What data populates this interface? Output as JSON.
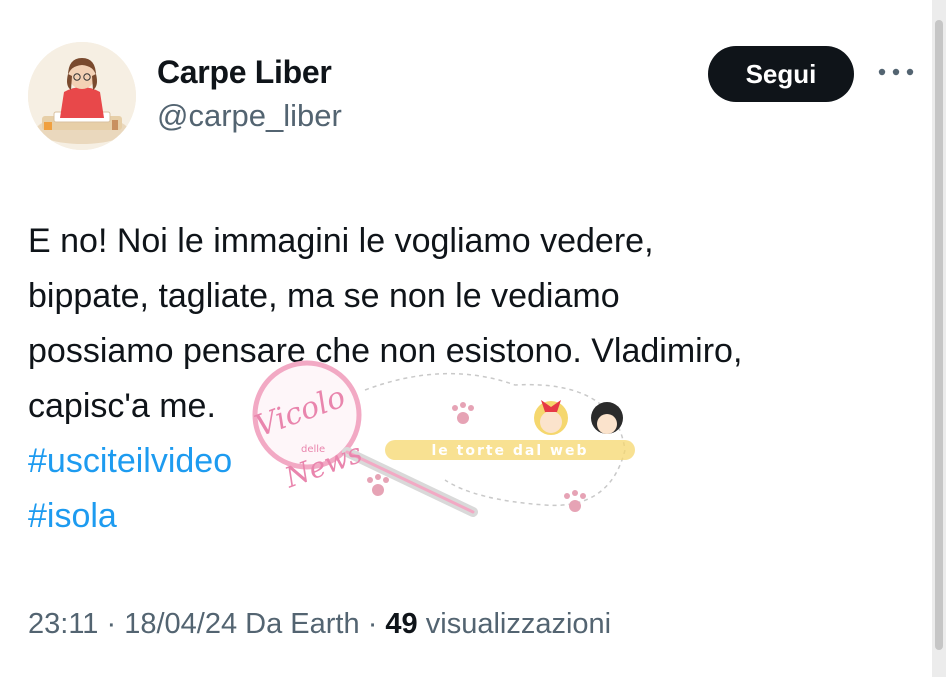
{
  "author": {
    "display_name": "Carpe Liber",
    "handle": "@carpe_liber",
    "avatar_icon": "illustrated-girl-reading-avatar"
  },
  "follow_button": {
    "label": "Segui"
  },
  "more_menu": {
    "icon": "more-horizontal-icon"
  },
  "tweet": {
    "text_lines": [
      "E no! Noi le immagini le vogliamo vedere,",
      "bippate, tagliate, ma se non le vediamo",
      "possiamo pensare che non esistono. Vladimiro,",
      "capisc'a me."
    ],
    "hashtags": [
      "#usciteilvideo",
      "#isola"
    ]
  },
  "metadata": {
    "time": "23:11",
    "separator": "·",
    "date": "18/04/24",
    "source": "Da Earth",
    "views_count": "49",
    "views_label": "visualizzazioni"
  },
  "watermark": {
    "vicolo_text": "Vicolo",
    "delle_text": "delle",
    "news_text": "News",
    "banner_text": "le torte dal web"
  },
  "colors": {
    "text_primary": "#0f1419",
    "text_secondary": "#536471",
    "hashtag": "#1d9bf0",
    "button_bg": "#0f1419",
    "button_text": "#ffffff",
    "watermark_pink": "#f2a9c4",
    "watermark_yellow": "#f5d76e"
  }
}
